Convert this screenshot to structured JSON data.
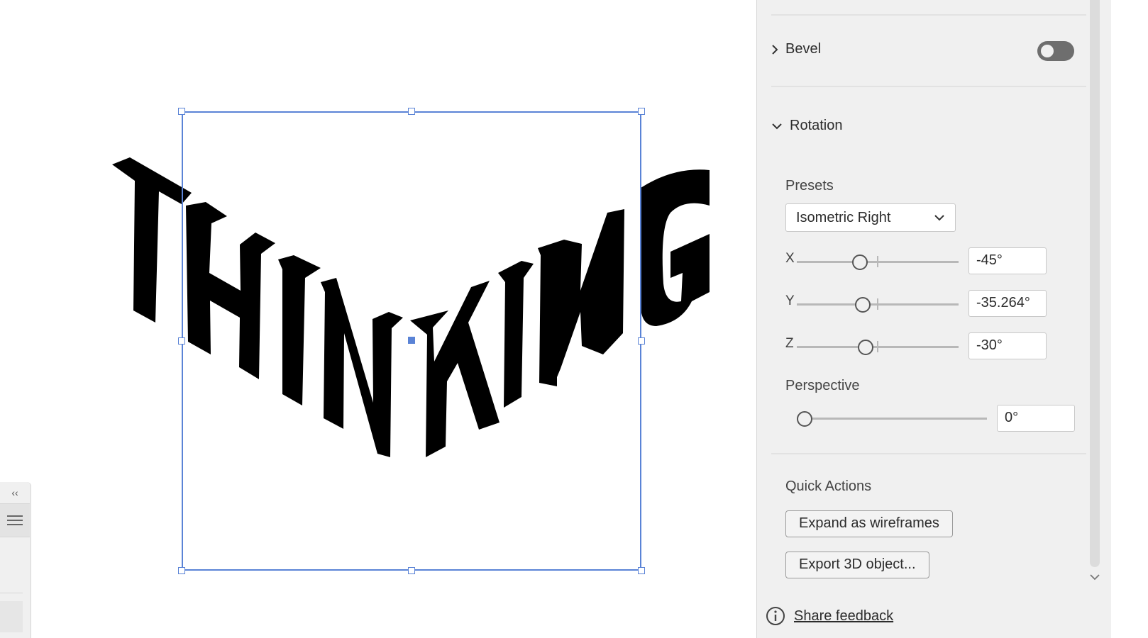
{
  "canvas": {
    "artwork_text": "THINKING"
  },
  "left_dock": {
    "collapse_label": "‹‹"
  },
  "panel": {
    "bevel": {
      "label": "Bevel",
      "enabled": false
    },
    "rotation": {
      "label": "Rotation",
      "presets_label": "Presets",
      "preset_value": "Isometric Right",
      "x": {
        "label": "X",
        "value": "-45°"
      },
      "y": {
        "label": "Y",
        "value": "-35.264°"
      },
      "z": {
        "label": "Z",
        "value": "-30°"
      },
      "perspective_label": "Perspective",
      "perspective_value": "0°"
    },
    "quick_actions": {
      "label": "Quick Actions",
      "expand_label": "Expand as wireframes",
      "export_label": "Export 3D object..."
    },
    "feedback_label": "Share feedback"
  },
  "colors": {
    "selection": "#5a83d6",
    "panel_bg": "#f0f0f0"
  }
}
